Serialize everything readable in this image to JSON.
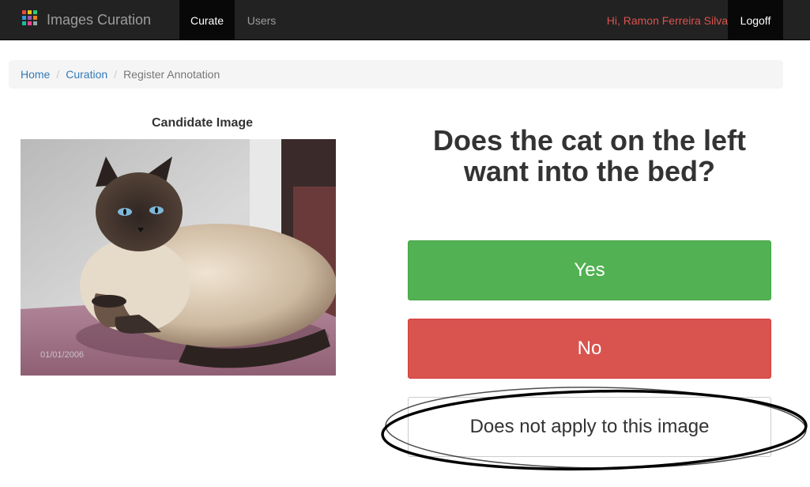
{
  "app": {
    "brand_title": "Images Curation",
    "brand_icon_colors": [
      "#e74c3c",
      "#f1c40f",
      "#2ecc71",
      "#3498db",
      "#9b59b6",
      "#e67e22",
      "#1abc9c",
      "#e84393",
      "#95a5a6"
    ]
  },
  "nav": {
    "items": [
      {
        "label": "Curate",
        "active": true
      },
      {
        "label": "Users",
        "active": false
      }
    ],
    "greeting": "Hi, Ramon Ferreira Silva",
    "logoff_label": "Logoff"
  },
  "breadcrumb": {
    "items": [
      "Home",
      "Curation",
      "Register Annotation"
    ]
  },
  "candidate": {
    "title": "Candidate Image",
    "image_description": "cat-photo",
    "photo_timestamp": "01/01/2006"
  },
  "question": {
    "text": "Does the cat on the left want into the bed?"
  },
  "answers": {
    "yes_label": "Yes",
    "no_label": "No",
    "not_apply_label": "Does not apply to this image"
  },
  "colors": {
    "navbar_bg": "#222222",
    "yes_green": "#52b152",
    "no_red": "#d9534f",
    "greeting_red": "#d9534f",
    "link_blue": "#337ab7"
  }
}
